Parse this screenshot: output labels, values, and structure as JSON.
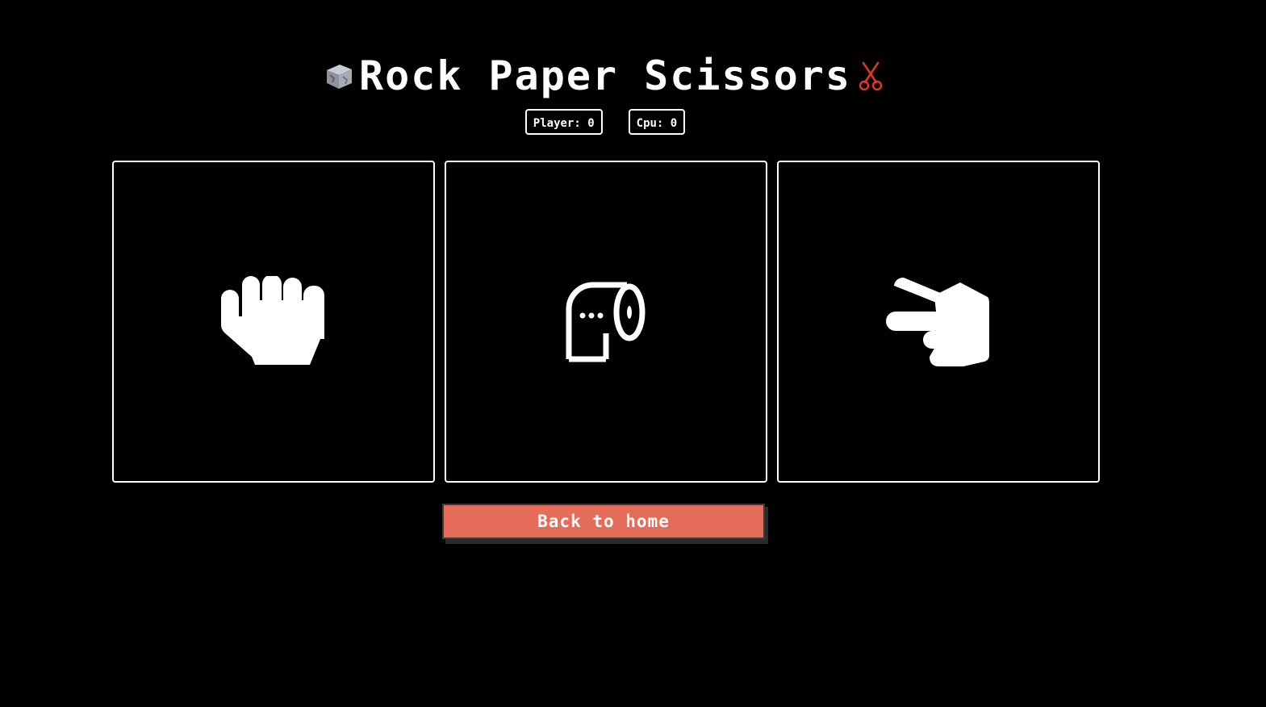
{
  "header": {
    "title": "Rock Paper Scissors",
    "left_icon": "rock-cube-icon",
    "right_icon": "scissors-icon",
    "right_icon_color": "#e0352b"
  },
  "scoreboard": {
    "player_label": "Player: 0",
    "cpu_label": "Cpu: 0"
  },
  "choices": [
    {
      "name": "rock",
      "icon": "fist-icon"
    },
    {
      "name": "paper",
      "icon": "toilet-paper-icon"
    },
    {
      "name": "scissors",
      "icon": "scissors-hand-icon"
    }
  ],
  "actions": {
    "back_label": "Back to home",
    "back_color": "#e56c58"
  }
}
